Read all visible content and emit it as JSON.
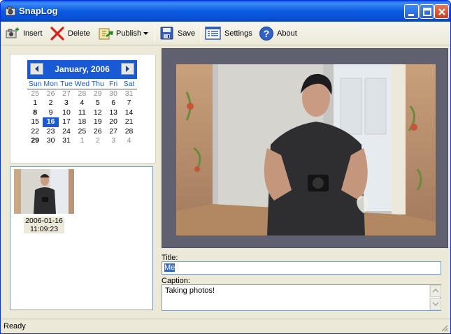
{
  "window": {
    "title": "SnapLog",
    "titlebar_color": "#0a52d6"
  },
  "toolbar": {
    "insert_label": "Insert",
    "delete_label": "Delete",
    "publish_label": "Publish",
    "save_label": "Save",
    "settings_label": "Settings",
    "about_label": "About"
  },
  "calendar": {
    "month_label": "January, 2006",
    "days_of_week": [
      "Sun",
      "Mon",
      "Tue",
      "Wed",
      "Thu",
      "Fri",
      "Sat"
    ],
    "weeks": [
      [
        "25",
        "26",
        "27",
        "28",
        "29",
        "30",
        "31"
      ],
      [
        "1",
        "2",
        "3",
        "4",
        "5",
        "6",
        "7"
      ],
      [
        "8",
        "9",
        "10",
        "11",
        "12",
        "13",
        "14"
      ],
      [
        "15",
        "16",
        "17",
        "18",
        "19",
        "20",
        "21"
      ],
      [
        "22",
        "23",
        "24",
        "25",
        "26",
        "27",
        "28"
      ],
      [
        "29",
        "30",
        "31",
        "1",
        "2",
        "3",
        "4"
      ]
    ],
    "selected_day": "16",
    "bold_days": [
      "8",
      "29"
    ],
    "accent_color": "#1a59d6"
  },
  "entries": [
    {
      "date": "2006-01-16",
      "time": "11:09:23"
    }
  ],
  "details": {
    "title_label": "Title:",
    "title_value": "Me",
    "caption_label": "Caption:",
    "caption_value": "Taking photos!"
  },
  "status": {
    "text": "Ready"
  }
}
